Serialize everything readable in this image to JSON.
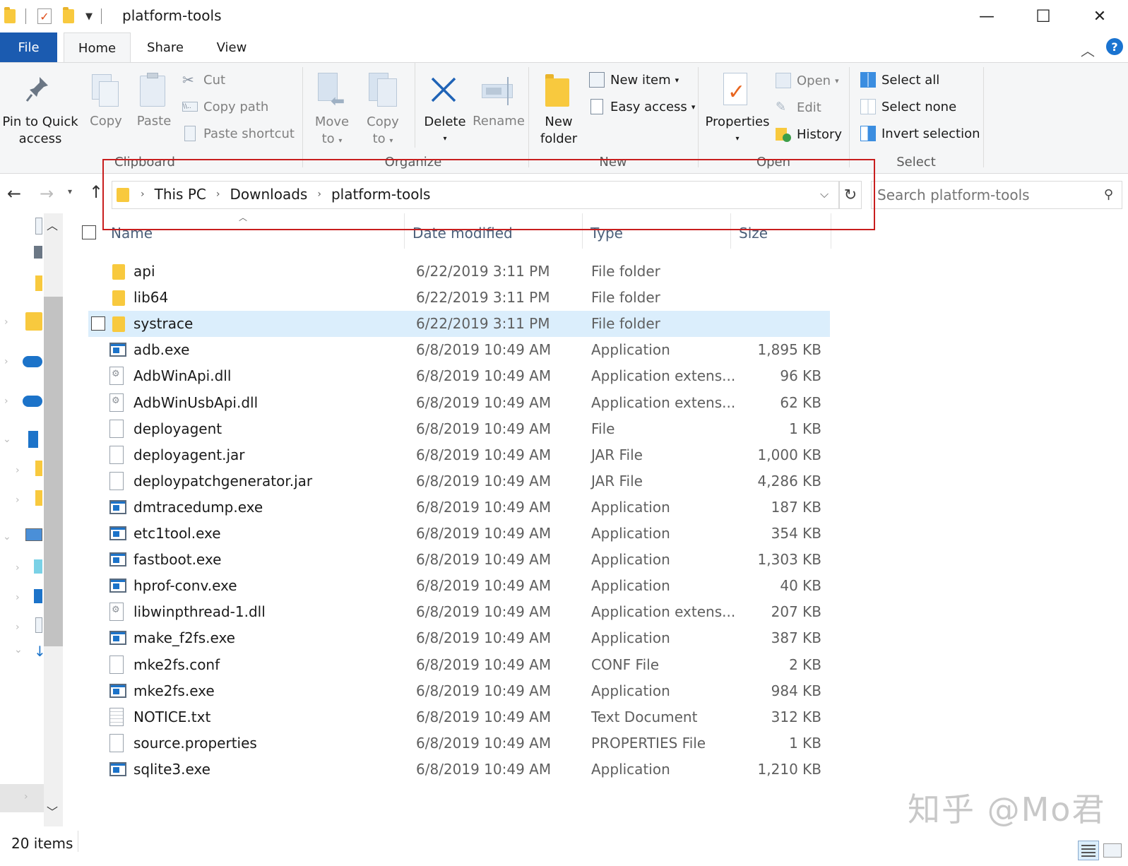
{
  "window": {
    "title": "platform-tools",
    "minimize": "—",
    "maximize": "☐",
    "close": "✕"
  },
  "tabs": [
    {
      "label": "File"
    },
    {
      "label": "Home"
    },
    {
      "label": "Share"
    },
    {
      "label": "View"
    }
  ],
  "help": "?",
  "ribbon": {
    "clipboard": {
      "pin_line1": "Pin to Quick",
      "pin_line2": "access",
      "copy": "Copy",
      "paste": "Paste",
      "cut": "Cut",
      "copy_path": "Copy path",
      "paste_shortcut": "Paste shortcut",
      "group": "Clipboard"
    },
    "organize": {
      "move_line1": "Move",
      "move_line2": "to",
      "copy_line1": "Copy",
      "copy_line2": "to",
      "delete": "Delete",
      "rename": "Rename",
      "group": "Organize"
    },
    "new": {
      "folder_line1": "New",
      "folder_line2": "folder",
      "new_item": "New item",
      "easy_access": "Easy access",
      "group": "New"
    },
    "open": {
      "properties": "Properties",
      "open": "Open",
      "edit": "Edit",
      "history": "History",
      "group": "Open"
    },
    "select": {
      "select_all": "Select all",
      "select_none": "Select none",
      "invert": "Invert selection",
      "group": "Select"
    }
  },
  "address": {
    "crumbs": [
      "This PC",
      "Downloads",
      "platform-tools"
    ],
    "search_placeholder": "Search platform-tools"
  },
  "columns": {
    "name": "Name",
    "date": "Date modified",
    "type": "Type",
    "size": "Size"
  },
  "files": [
    {
      "name": "api",
      "date": "6/22/2019 3:11 PM",
      "type": "File folder",
      "size": "",
      "icon": "folder-icon"
    },
    {
      "name": "lib64",
      "date": "6/22/2019 3:11 PM",
      "type": "File folder",
      "size": "",
      "icon": "folder-icon"
    },
    {
      "name": "systrace",
      "date": "6/22/2019 3:11 PM",
      "type": "File folder",
      "size": "",
      "icon": "folder-icon"
    },
    {
      "name": "adb.exe",
      "date": "6/8/2019 10:49 AM",
      "type": "Application",
      "size": "1,895 KB",
      "icon": "exe-icon"
    },
    {
      "name": "AdbWinApi.dll",
      "date": "6/8/2019 10:49 AM",
      "type": "Application extens...",
      "size": "96 KB",
      "icon": "dll-icon"
    },
    {
      "name": "AdbWinUsbApi.dll",
      "date": "6/8/2019 10:49 AM",
      "type": "Application extens...",
      "size": "62 KB",
      "icon": "dll-icon"
    },
    {
      "name": "deployagent",
      "date": "6/8/2019 10:49 AM",
      "type": "File",
      "size": "1 KB",
      "icon": "file-icon"
    },
    {
      "name": "deployagent.jar",
      "date": "6/8/2019 10:49 AM",
      "type": "JAR File",
      "size": "1,000 KB",
      "icon": "file-icon"
    },
    {
      "name": "deploypatchgenerator.jar",
      "date": "6/8/2019 10:49 AM",
      "type": "JAR File",
      "size": "4,286 KB",
      "icon": "file-icon"
    },
    {
      "name": "dmtracedump.exe",
      "date": "6/8/2019 10:49 AM",
      "type": "Application",
      "size": "187 KB",
      "icon": "exe-icon"
    },
    {
      "name": "etc1tool.exe",
      "date": "6/8/2019 10:49 AM",
      "type": "Application",
      "size": "354 KB",
      "icon": "exe-icon"
    },
    {
      "name": "fastboot.exe",
      "date": "6/8/2019 10:49 AM",
      "type": "Application",
      "size": "1,303 KB",
      "icon": "exe-icon"
    },
    {
      "name": "hprof-conv.exe",
      "date": "6/8/2019 10:49 AM",
      "type": "Application",
      "size": "40 KB",
      "icon": "exe-icon"
    },
    {
      "name": "libwinpthread-1.dll",
      "date": "6/8/2019 10:49 AM",
      "type": "Application extens...",
      "size": "207 KB",
      "icon": "dll-icon"
    },
    {
      "name": "make_f2fs.exe",
      "date": "6/8/2019 10:49 AM",
      "type": "Application",
      "size": "387 KB",
      "icon": "exe-icon"
    },
    {
      "name": "mke2fs.conf",
      "date": "6/8/2019 10:49 AM",
      "type": "CONF File",
      "size": "2 KB",
      "icon": "file-icon"
    },
    {
      "name": "mke2fs.exe",
      "date": "6/8/2019 10:49 AM",
      "type": "Application",
      "size": "984 KB",
      "icon": "exe-icon"
    },
    {
      "name": "NOTICE.txt",
      "date": "6/8/2019 10:49 AM",
      "type": "Text Document",
      "size": "312 KB",
      "icon": "txt-icon"
    },
    {
      "name": "source.properties",
      "date": "6/8/2019 10:49 AM",
      "type": "PROPERTIES File",
      "size": "1 KB",
      "icon": "file-icon"
    },
    {
      "name": "sqlite3.exe",
      "date": "6/8/2019 10:49 AM",
      "type": "Application",
      "size": "1,210 KB",
      "icon": "exe-icon"
    }
  ],
  "selected_row": 2,
  "status": {
    "items": "20 items"
  },
  "watermark": "知乎 @Mo君",
  "colors": {
    "file_tab": "#1b5bb0",
    "selection": "#dbeefc",
    "highlight_box": "#c81e1e",
    "folder": "#f8c93e"
  }
}
